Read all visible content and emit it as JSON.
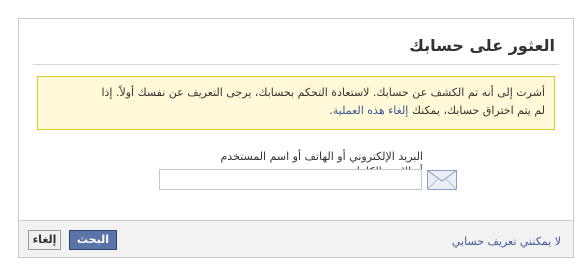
{
  "dialog": {
    "title": "العثور على حسابك",
    "warning": {
      "text_line1": "أشرت إلى أنه تم الكشف عن حسابك. لاستعادة التحكم بحسابك، يرجى التعريف عن نفسك أولاً. إذا",
      "text_line2_prefix": "لم يتم اختراق حسابك، يمكنك ",
      "link": "إلغاء هذه العملية",
      "text_line2_suffix": "."
    },
    "field": {
      "label": "البريد الإلكتروني أو الهاتف أو اسم المستخدم أو الاسم الكامل",
      "value": "",
      "icon": "envelope-icon"
    },
    "footer": {
      "cant_identify_link": "لا يمكنني تعريف حسابي",
      "search_button": "البحث",
      "cancel_button": "إلغاء"
    }
  },
  "colors": {
    "link": "#3b5998",
    "warning_bg": "#fff9d7",
    "warning_border": "#e2c822",
    "primary_button": "#5b74a8"
  }
}
